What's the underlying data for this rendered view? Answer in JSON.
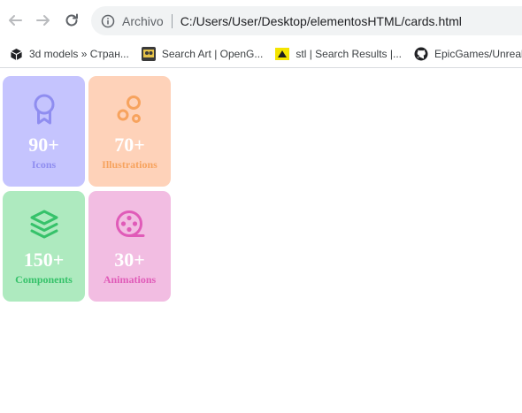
{
  "browser": {
    "scheme_label": "Archivo",
    "url": "C:/Users/User/Desktop/elementosHTML/cards.html"
  },
  "bookmarks": [
    {
      "label": "3d models » Стран...",
      "icon": "box-icon"
    },
    {
      "label": "Search Art | OpenG...",
      "icon": "opengameart-icon"
    },
    {
      "label": "stl | Search Results |...",
      "icon": "stl-icon"
    },
    {
      "label": "EpicGames/UnrealE",
      "icon": "github-icon"
    }
  ],
  "cards": [
    {
      "count": "90+",
      "label": "Icons",
      "icon": "award-ribbon-icon",
      "bg": "#c5c4fe",
      "accent": "#8f8df0"
    },
    {
      "count": "70+",
      "label": "Illustrations",
      "icon": "bubbles-icon",
      "bg": "#fed2b9",
      "accent": "#f7a35e"
    },
    {
      "count": "150+",
      "label": "Components",
      "icon": "layers-icon",
      "bg": "#aeeabf",
      "accent": "#36c26a"
    },
    {
      "count": "30+",
      "label": "Animations",
      "icon": "film-reel-icon",
      "bg": "#f2bde2",
      "accent": "#e05bb8"
    }
  ]
}
